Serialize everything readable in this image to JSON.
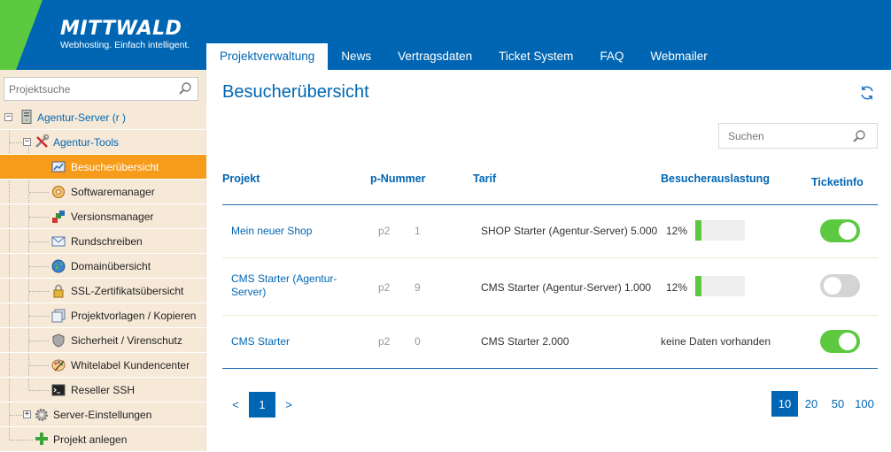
{
  "brand": {
    "name": "MITTWALD",
    "tagline": "Webhosting. Einfach intelligent."
  },
  "nav": {
    "tabs": [
      {
        "label": "Projektverwaltung",
        "active": true
      },
      {
        "label": "News"
      },
      {
        "label": "Vertragsdaten"
      },
      {
        "label": "Ticket System"
      },
      {
        "label": "FAQ"
      },
      {
        "label": "Webmailer"
      }
    ]
  },
  "sidebar": {
    "search_placeholder": "Projektsuche",
    "server_label": "Agentur-Server (r        )",
    "tools_label": "Agentur-Tools",
    "items": [
      {
        "label": "Besucherübersicht",
        "icon": "chart-icon",
        "active": true
      },
      {
        "label": "Softwaremanager",
        "icon": "software-icon"
      },
      {
        "label": "Versionsmanager",
        "icon": "version-icon"
      },
      {
        "label": "Rundschreiben",
        "icon": "mail-icon"
      },
      {
        "label": "Domainübersicht",
        "icon": "globe-icon"
      },
      {
        "label": "SSL-Zertifikatsübersicht",
        "icon": "lock-icon"
      },
      {
        "label": "Projektvorlagen / Kopieren",
        "icon": "copy-icon"
      },
      {
        "label": "Sicherheit / Virenschutz",
        "icon": "shield-icon"
      },
      {
        "label": "Whitelabel Kundencenter",
        "icon": "palette-icon"
      },
      {
        "label": "Reseller SSH",
        "icon": "terminal-icon"
      }
    ],
    "server_settings_label": "Server-Einstellungen",
    "create_project_label": "Projekt anlegen"
  },
  "main": {
    "title": "Besucherübersicht",
    "search_placeholder": "Suchen",
    "columns": {
      "project": "Projekt",
      "pnumber": "p-Nummer",
      "tariff": "Tarif",
      "load": "Besucherauslastung",
      "ticket": "Ticketinfo"
    },
    "rows": [
      {
        "project": "Mein neuer Shop",
        "p_prefix": "p2",
        "p_num": "1",
        "tariff": "SHOP Starter (Agentur-Server) 5.000",
        "load_text": "12%",
        "load_fraction": 0.12,
        "ticket_on": true
      },
      {
        "project": "CMS Starter (Agentur-Server)",
        "p_prefix": "p2",
        "p_num": "9",
        "tariff": "CMS Starter (Agentur-Server) 1.000",
        "load_text": "12%",
        "load_fraction": 0.12,
        "ticket_on": false
      },
      {
        "project": "CMS Starter",
        "p_prefix": "p2",
        "p_num": "0",
        "tariff": "CMS Starter 2.000",
        "load_text": "keine Daten vorhanden",
        "load_fraction": null,
        "ticket_on": true
      }
    ],
    "pagination": {
      "prev": "<",
      "current": "1",
      "next": ">",
      "page_sizes": [
        "10",
        "20",
        "50",
        "100"
      ],
      "active_size": "10"
    }
  },
  "colors": {
    "brand_blue": "#0066b3",
    "brand_green": "#5cc940",
    "active_orange": "#f79c1a",
    "sidebar_bg": "#f7e9d8"
  }
}
